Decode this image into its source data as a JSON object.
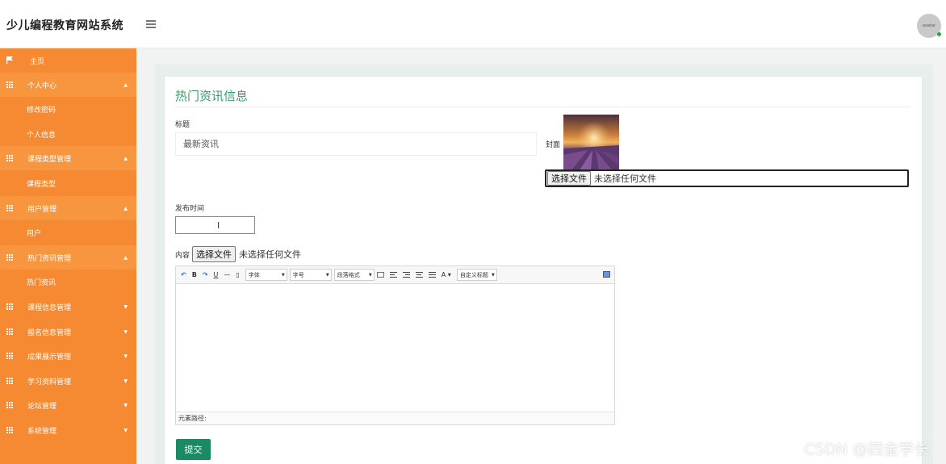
{
  "app": {
    "title": "少儿编程教育网站系统",
    "avatar_text": "avatar"
  },
  "sidebar": {
    "items": [
      {
        "label": "主页",
        "icon": "flag-icon",
        "type": "plain"
      },
      {
        "label": "个人中心",
        "icon": "grid-icon",
        "type": "group",
        "caret": "^"
      },
      {
        "label": "修改密码",
        "type": "sub"
      },
      {
        "label": "个人信息",
        "type": "sub"
      },
      {
        "label": "课程类型管理",
        "icon": "grid-icon",
        "type": "group",
        "caret": "^"
      },
      {
        "label": "课程类型",
        "type": "sub"
      },
      {
        "label": "用户管理",
        "icon": "grid-icon",
        "type": "group",
        "caret": "^"
      },
      {
        "label": "用户",
        "type": "sub"
      },
      {
        "label": "热门资讯管理",
        "icon": "grid-icon",
        "type": "group",
        "caret": "^"
      },
      {
        "label": "热门资讯",
        "type": "sub"
      },
      {
        "label": "课程信息管理",
        "icon": "grid-icon",
        "type": "plain",
        "caret": "v"
      },
      {
        "label": "报名信息管理",
        "icon": "grid-icon",
        "type": "plain",
        "caret": "v"
      },
      {
        "label": "成果展示管理",
        "icon": "grid-icon",
        "type": "plain",
        "caret": "v"
      },
      {
        "label": "学习资料管理",
        "icon": "grid-icon",
        "type": "plain",
        "caret": "v"
      },
      {
        "label": "论坛管理",
        "icon": "grid-icon",
        "type": "plain",
        "caret": "v"
      },
      {
        "label": "系统管理",
        "icon": "grid-icon",
        "type": "plain",
        "caret": "v"
      }
    ]
  },
  "form": {
    "title": "热门资讯信息",
    "title_label": "标题",
    "title_value": "最新资讯",
    "cover_label": "封面",
    "file_button": "选择文件",
    "file_none": "未选择任何文件",
    "date_label": "发布时间",
    "date_value": "",
    "content_label": "内容",
    "submit": "提交"
  },
  "editor": {
    "font_family": "字体",
    "font_size": "字号",
    "paragraph": "段落格式",
    "custom_title": "自定义标题",
    "font_color": "A",
    "bold": "B",
    "underline": "U",
    "hr": "—",
    "path_label": "元素路径:"
  },
  "watermark": "CSDN @四金学长",
  "colors": {
    "sidebar": "#f58a33",
    "sidebar_group": "#f7963f",
    "accent": "#3d9a6b",
    "submit": "#1b8a63"
  }
}
